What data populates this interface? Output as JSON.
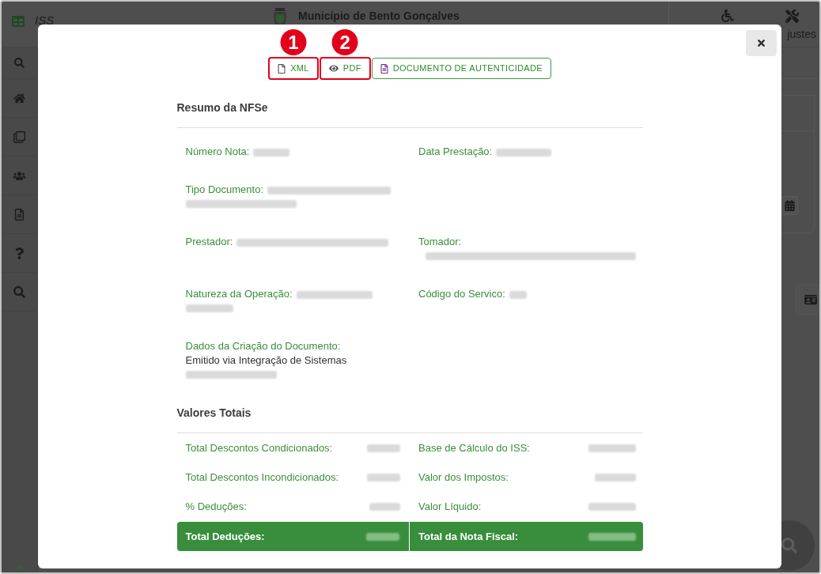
{
  "header": {
    "app_name": "ISS",
    "title": "Município de Bento Gonçalves",
    "settings_label": "justes"
  },
  "dialog": {
    "toolbar": [
      {
        "kind": "xml",
        "label": "XML",
        "annotation": "1"
      },
      {
        "kind": "pdf",
        "label": "PDF",
        "annotation": "2"
      },
      {
        "kind": "document",
        "label": "DOCUMENTO DE AUTENTICIDADE"
      }
    ],
    "summary": {
      "title": "Resumo da NFSe",
      "rows": [
        [
          {
            "kind": "inline",
            "label": "Número Nota:",
            "value_blurred": true
          },
          {
            "kind": "inline",
            "label": "Data Prestação:",
            "value_blurred": true
          }
        ],
        [
          {
            "kind": "inline",
            "label": "Tipo Documento:",
            "value_blurred": true
          }
        ],
        [
          {
            "kind": "inline",
            "label": "Prestador:",
            "value_blurred": true
          },
          {
            "kind": "stacked",
            "label": "Tomador:",
            "value_blurred": true
          }
        ],
        [
          {
            "kind": "inline",
            "label": "Natureza da Operação:",
            "value_blurred": true
          },
          {
            "kind": "inline",
            "label": "Código do Servico:",
            "value_blurred": true
          }
        ],
        [
          {
            "kind": "stacked",
            "label": "Dados da Criação do Documento:",
            "value": "Emitido via Integração de Sistemas",
            "value_blurred": true
          }
        ]
      ]
    },
    "totals": {
      "title": "Valores Totais",
      "rows": [
        [
          {
            "label": "Total Descontos Condicionados:",
            "value_blurred": true
          },
          {
            "label": "Base de Cálculo do ISS:",
            "value_blurred": true
          }
        ],
        [
          {
            "label": "Total Descontos Incondicionados:",
            "value_blurred": true
          },
          {
            "label": "Valor dos Impostos:",
            "value_blurred": true
          }
        ],
        [
          {
            "label": "% Deduções:",
            "value_blurred": true
          },
          {
            "label": "Valor Líquido:",
            "value_blurred": true
          }
        ]
      ],
      "grand_totals": [
        {
          "label": "Total Deduções:",
          "value_blurred": true
        },
        {
          "label": "Total da Nota Fiscal:",
          "value_blurred": true
        }
      ]
    }
  }
}
